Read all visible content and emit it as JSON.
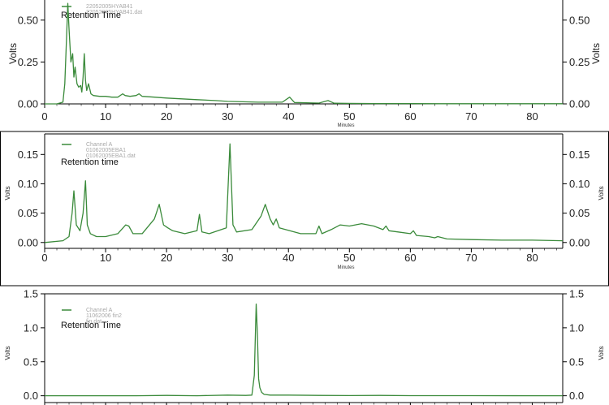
{
  "chart_data": [
    {
      "type": "line",
      "title": "",
      "annotation": "Retention Time",
      "legend": [
        "22052005HYAB41",
        "22052005HYAB41.dat"
      ],
      "legend_placement": "top-left",
      "xlabel": "Minutes",
      "ylabel_left": "Volts",
      "ylabel_right": "Volts",
      "xlim": [
        0,
        85
      ],
      "ylim": [
        0,
        0.62
      ],
      "x_ticks": [
        0,
        10,
        20,
        30,
        40,
        50,
        60,
        70,
        80
      ],
      "y_ticks": [
        0.0,
        0.25,
        0.5
      ],
      "y_tick_labels": [
        "0.00",
        "0.25",
        "0.50"
      ],
      "line_color": "#3a8a3a",
      "series": [
        {
          "x": [
            0,
            2,
            3,
            3.3,
            3.6,
            3.8,
            4.0,
            4.3,
            4.6,
            4.8,
            5.0,
            5.3,
            5.6,
            5.9,
            6.1,
            6.3,
            6.5,
            6.7,
            6.9,
            7.2,
            7.6,
            8.0,
            9,
            10,
            11,
            12,
            12.8,
            13.2,
            14,
            15,
            15.5,
            16,
            18,
            20,
            25,
            28,
            30,
            35,
            39,
            40.2,
            41,
            45,
            46.5,
            47.5,
            50,
            55,
            60,
            65,
            70,
            85
          ],
          "y": [
            0,
            0,
            0.01,
            0.12,
            0.4,
            0.6,
            0.45,
            0.25,
            0.3,
            0.16,
            0.22,
            0.12,
            0.1,
            0.11,
            0.07,
            0.16,
            0.3,
            0.14,
            0.08,
            0.12,
            0.06,
            0.05,
            0.045,
            0.045,
            0.04,
            0.04,
            0.06,
            0.05,
            0.045,
            0.05,
            0.06,
            0.045,
            0.04,
            0.035,
            0.025,
            0.02,
            0.015,
            0.01,
            0.01,
            0.04,
            0.008,
            0.005,
            0.02,
            0.004,
            0.003,
            0.002,
            0.002,
            0.001,
            0.001,
            0.001
          ]
        }
      ]
    },
    {
      "type": "line",
      "title": "",
      "annotation": "Retention time",
      "legend": [
        "Channel A",
        "01062005EBA1",
        "01062005EBA1.dat"
      ],
      "legend_placement": "top-left",
      "xlabel": "Minutes",
      "ylabel_left": "Volts",
      "ylabel_right": "Volts",
      "xlim": [
        0,
        85
      ],
      "ylim": [
        -0.01,
        0.185
      ],
      "x_ticks": [
        0,
        10,
        20,
        30,
        40,
        50,
        60,
        70,
        80
      ],
      "y_ticks": [
        0.0,
        0.05,
        0.1,
        0.15
      ],
      "y_tick_labels": [
        "0.00",
        "0.05",
        "0.10",
        "0.15"
      ],
      "line_color": "#3a8a3a",
      "series": [
        {
          "x": [
            0,
            3,
            4,
            4.5,
            4.8,
            5.2,
            5.8,
            6.3,
            6.7,
            7.0,
            7.5,
            8.5,
            10,
            12,
            13.3,
            13.8,
            14.5,
            16,
            18,
            18.8,
            19.5,
            20.2,
            21,
            23,
            25,
            25.4,
            25.8,
            27,
            29.8,
            30.4,
            30.9,
            31.5,
            34,
            35.5,
            36.2,
            37,
            37.5,
            38,
            38.5,
            42,
            44.5,
            45,
            45.5,
            47,
            48.5,
            50,
            52,
            54,
            55.5,
            56,
            56.5,
            58,
            60,
            60.5,
            61,
            63,
            64,
            64.5,
            66,
            70,
            75,
            80,
            85
          ],
          "y": [
            0.0,
            0.003,
            0.01,
            0.05,
            0.088,
            0.03,
            0.02,
            0.05,
            0.105,
            0.03,
            0.015,
            0.01,
            0.01,
            0.015,
            0.03,
            0.028,
            0.015,
            0.015,
            0.04,
            0.065,
            0.03,
            0.025,
            0.02,
            0.015,
            0.02,
            0.048,
            0.018,
            0.015,
            0.025,
            0.168,
            0.03,
            0.018,
            0.022,
            0.045,
            0.065,
            0.04,
            0.03,
            0.04,
            0.025,
            0.015,
            0.015,
            0.028,
            0.015,
            0.022,
            0.03,
            0.028,
            0.032,
            0.028,
            0.022,
            0.028,
            0.02,
            0.018,
            0.015,
            0.02,
            0.012,
            0.01,
            0.008,
            0.01,
            0.006,
            0.005,
            0.004,
            0.004,
            0.003
          ]
        }
      ]
    },
    {
      "type": "line",
      "title": "",
      "annotation": "Retention Time",
      "legend": [
        "Channel A",
        "11062006 fin2",
        "fin.dat"
      ],
      "legend_placement": "top-left",
      "xlabel": "",
      "ylabel_left": "Volts",
      "ylabel_right": "Volts",
      "xlim": [
        0,
        85
      ],
      "ylim": [
        -0.1,
        1.5
      ],
      "x_ticks": [
        0,
        10,
        20,
        30,
        40,
        50,
        60,
        70,
        80
      ],
      "y_ticks": [
        0.0,
        0.5,
        1.0,
        1.5
      ],
      "y_tick_labels": [
        "0.0",
        "0.5",
        "1.0",
        "1.5"
      ],
      "line_color": "#3a8a3a",
      "series": [
        {
          "x": [
            0,
            10,
            15,
            20,
            25,
            30,
            33,
            34,
            34.4,
            34.7,
            34.9,
            35.1,
            35.3,
            35.6,
            36.0,
            37,
            40,
            45,
            50,
            55,
            60,
            70,
            85
          ],
          "y": [
            0.0,
            0.0,
            0.0,
            0.005,
            0.0,
            0.01,
            0.005,
            0.01,
            0.3,
            1.35,
            0.9,
            0.25,
            0.12,
            0.05,
            0.02,
            0.01,
            0.01,
            0.005,
            0.003,
            0.005,
            0.002,
            0.002,
            0.0
          ]
        }
      ]
    }
  ]
}
